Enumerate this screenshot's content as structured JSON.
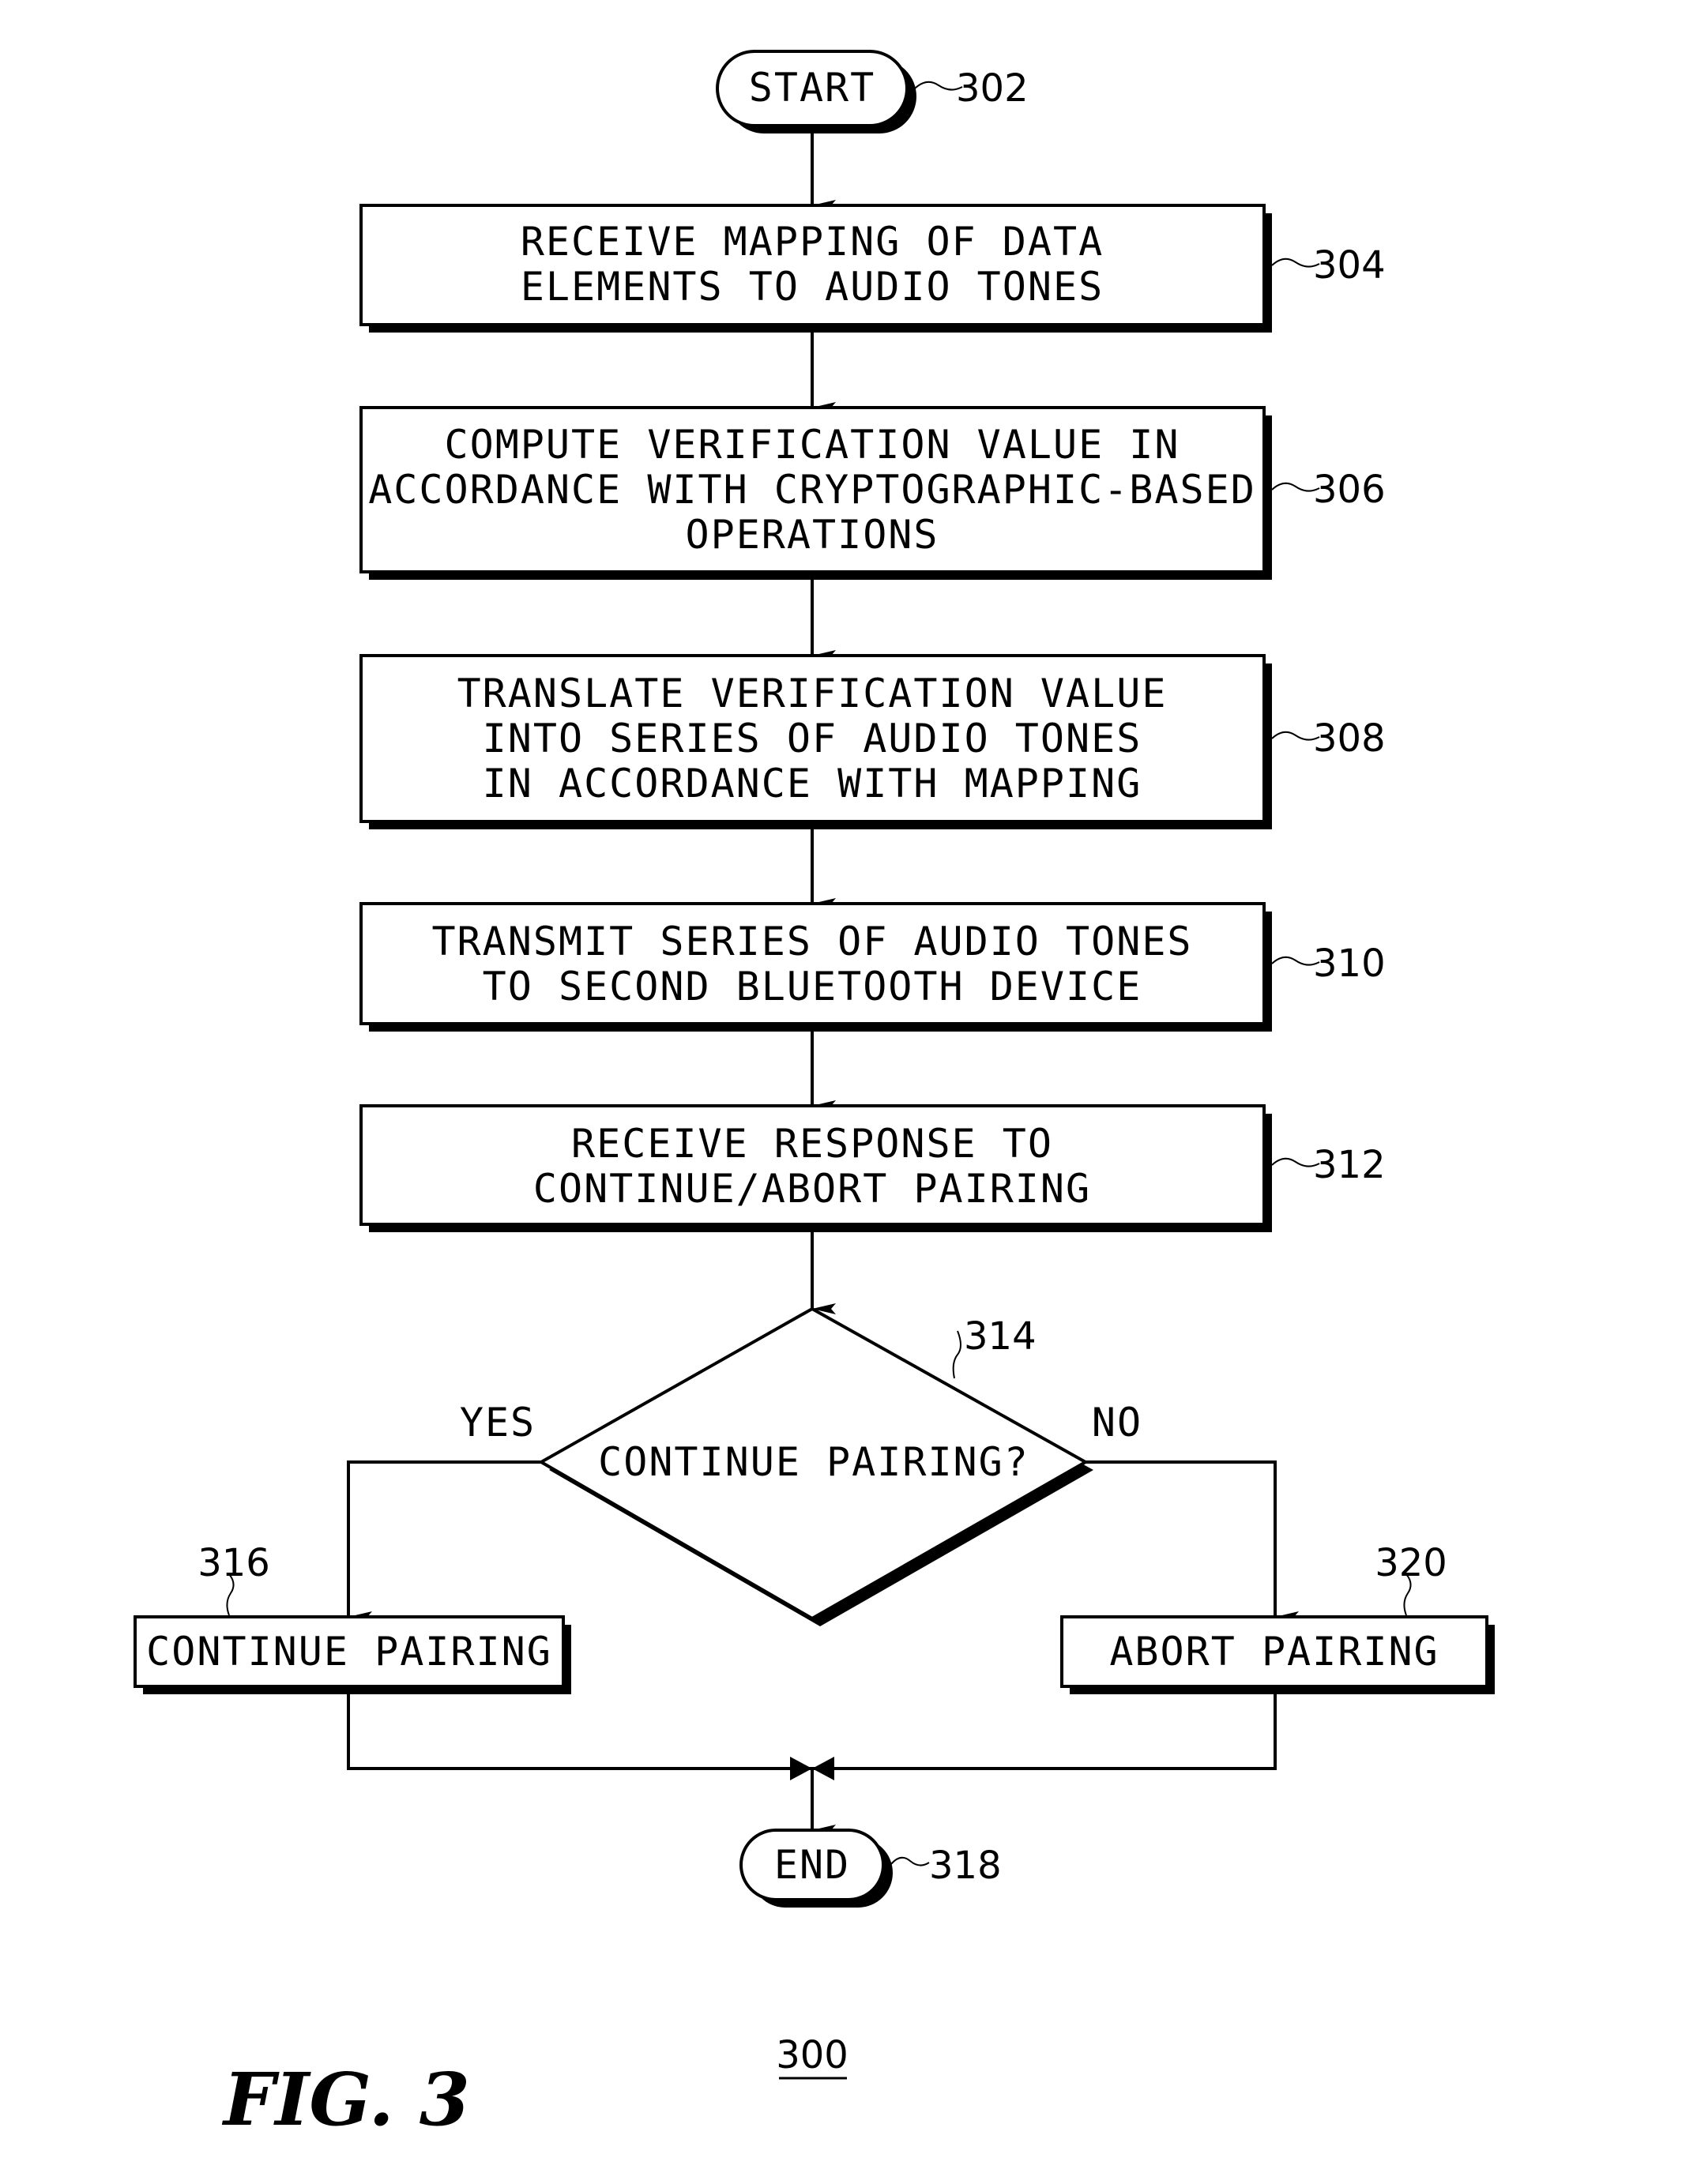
{
  "figure": {
    "title": "FIG. 3",
    "reference": "300"
  },
  "nodes": {
    "start": {
      "label": "START",
      "ref": "302"
    },
    "n304": {
      "lines": [
        "RECEIVE MAPPING OF DATA",
        "ELEMENTS TO AUDIO TONES"
      ],
      "ref": "304"
    },
    "n306": {
      "lines": [
        "COMPUTE VERIFICATION VALUE IN",
        "ACCORDANCE WITH CRYPTOGRAPHIC-BASED",
        "OPERATIONS"
      ],
      "ref": "306"
    },
    "n308": {
      "lines": [
        "TRANSLATE VERIFICATION VALUE",
        "INTO SERIES OF AUDIO TONES",
        "IN ACCORDANCE WITH MAPPING"
      ],
      "ref": "308"
    },
    "n310": {
      "lines": [
        "TRANSMIT SERIES OF AUDIO TONES",
        "TO SECOND BLUETOOTH DEVICE"
      ],
      "ref": "310"
    },
    "n312": {
      "lines": [
        "RECEIVE RESPONSE TO",
        "CONTINUE/ABORT PAIRING"
      ],
      "ref": "312"
    },
    "decision": {
      "label": "CONTINUE PAIRING?",
      "ref": "314",
      "yes": "YES",
      "no": "NO"
    },
    "n316": {
      "label": "CONTINUE PAIRING",
      "ref": "316"
    },
    "n320": {
      "label": "ABORT PAIRING",
      "ref": "320"
    },
    "end": {
      "label": "END",
      "ref": "318"
    }
  }
}
